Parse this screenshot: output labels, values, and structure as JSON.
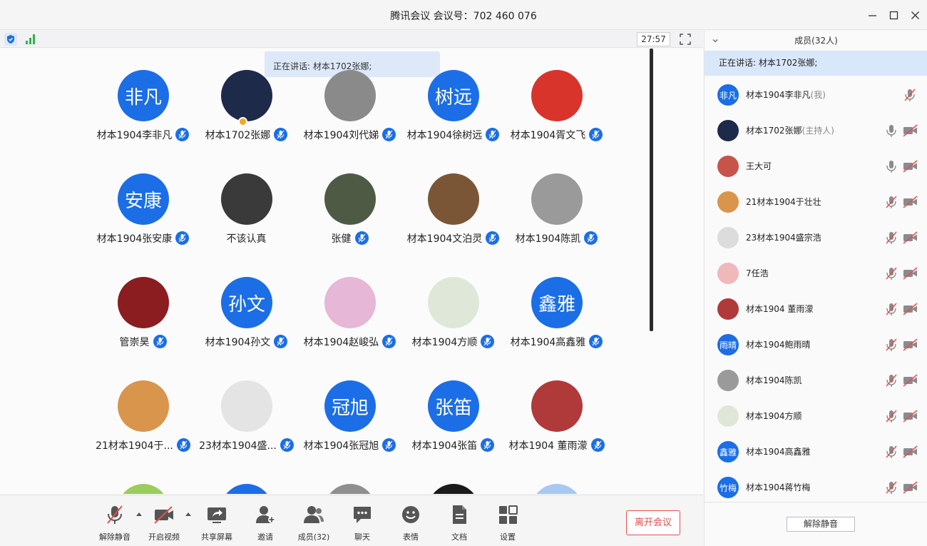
{
  "window": {
    "title": "腾讯会议 会议号：702 460 076"
  },
  "strip": {
    "timer": "27:57"
  },
  "main": {
    "speaking_tip": "正在讲话: 材本1702张娜;",
    "tiles": [
      {
        "name": "材本1904李非凡",
        "avatar_text": "非凡",
        "avatar_color": "#1b6ee6",
        "mic": true
      },
      {
        "name": "材本1702张娜",
        "avatar_text": "",
        "avatar_color": "#1d2a4a",
        "mic": true,
        "host": true
      },
      {
        "name": "材本1904刘代娣",
        "avatar_text": "",
        "avatar_color": "#8a8a8a",
        "mic": true
      },
      {
        "name": "材本1904徐树远",
        "avatar_text": "树远",
        "avatar_color": "#1b6ee6",
        "mic": true
      },
      {
        "name": "材本1904胥文飞",
        "avatar_text": "",
        "avatar_color": "#d8342c",
        "mic": true
      },
      {
        "name": "材本1904张安康",
        "avatar_text": "安康",
        "avatar_color": "#1b6ee6",
        "mic": true
      },
      {
        "name": "不该认真",
        "avatar_text": "",
        "avatar_color": "#3a3a3a",
        "mic": false
      },
      {
        "name": "张健",
        "avatar_text": "",
        "avatar_color": "#4e5a44",
        "mic": true
      },
      {
        "name": "材本1904文泊灵",
        "avatar_text": "",
        "avatar_color": "#7b5636",
        "mic": true
      },
      {
        "name": "材本1904陈凯",
        "avatar_text": "",
        "avatar_color": "#9a9a9a",
        "mic": true
      },
      {
        "name": "管崇昊",
        "avatar_text": "",
        "avatar_color": "#8b1c20",
        "mic": true
      },
      {
        "name": "材本1904孙文",
        "avatar_text": "孙文",
        "avatar_color": "#1b6ee6",
        "mic": true
      },
      {
        "name": "材本1904赵峻弘",
        "avatar_text": "",
        "avatar_color": "#e6b7d6",
        "mic": true
      },
      {
        "name": "材本1904方顺",
        "avatar_text": "",
        "avatar_color": "#dfe8d8",
        "mic": true
      },
      {
        "name": "材本1904高鑫雅",
        "avatar_text": "鑫雅",
        "avatar_color": "#1b6ee6",
        "mic": true
      },
      {
        "name": "21材本1904于...",
        "avatar_text": "",
        "avatar_color": "#d9954c",
        "mic": true
      },
      {
        "name": "23材本1904盛...",
        "avatar_text": "",
        "avatar_color": "#e4e4e4",
        "mic": true
      },
      {
        "name": "材本1904张冠旭",
        "avatar_text": "冠旭",
        "avatar_color": "#1b6ee6",
        "mic": true
      },
      {
        "name": "材本1904张笛",
        "avatar_text": "张笛",
        "avatar_color": "#1b6ee6",
        "mic": true
      },
      {
        "name": "材本1904 董雨濛",
        "avatar_text": "",
        "avatar_color": "#b0393a",
        "mic": true
      }
    ],
    "partial_row_colors": [
      "#9ccc5b",
      "#1b6ee6",
      "#8f8f8f",
      "#1a1a1a",
      "#a9c8ef"
    ]
  },
  "toolbar": {
    "unmute": "解除静音",
    "video": "开启视频",
    "share": "共享屏幕",
    "invite": "邀请",
    "members": "成员(32)",
    "chat": "聊天",
    "emoji": "表情",
    "docs": "文档",
    "settings": "设置",
    "leave": "离开会议"
  },
  "panel": {
    "header": "成员(32人)",
    "speaking": "正在讲话: 材本1702张娜;",
    "members": [
      {
        "name": "材本1904李非凡",
        "tag": "(我)",
        "avatar_text": "非凡",
        "avatar_color": "#1b6ee6",
        "mic": "muted",
        "cam": "none"
      },
      {
        "name": "材本1702张娜",
        "tag": "(主持人)",
        "avatar_text": "",
        "avatar_color": "#1d2a4a",
        "mic": "on",
        "cam": "off"
      },
      {
        "name": "王大可",
        "tag": "",
        "avatar_text": "",
        "avatar_color": "#c7544a",
        "mic": "on",
        "cam": "off"
      },
      {
        "name": "21材本1904于壮壮",
        "tag": "",
        "avatar_text": "",
        "avatar_color": "#d9954c",
        "mic": "muted",
        "cam": "off"
      },
      {
        "name": "23材本1904盛宗浩",
        "tag": "",
        "avatar_text": "",
        "avatar_color": "#dcdcdc",
        "mic": "muted",
        "cam": "off"
      },
      {
        "name": "7任浩",
        "tag": "",
        "avatar_text": "",
        "avatar_color": "#f0b8bb",
        "mic": "muted",
        "cam": "off"
      },
      {
        "name": "材本1904 董雨濛",
        "tag": "",
        "avatar_text": "",
        "avatar_color": "#b0393a",
        "mic": "muted",
        "cam": "off"
      },
      {
        "name": "材本1904鲍雨晴",
        "tag": "",
        "avatar_text": "雨晴",
        "avatar_color": "#1b6ee6",
        "mic": "muted",
        "cam": "off"
      },
      {
        "name": "材本1904陈凯",
        "tag": "",
        "avatar_text": "",
        "avatar_color": "#9a9a9a",
        "mic": "muted",
        "cam": "off"
      },
      {
        "name": "材本1904方顺",
        "tag": "",
        "avatar_text": "",
        "avatar_color": "#dfe8d8",
        "mic": "muted",
        "cam": "off"
      },
      {
        "name": "材本1904高鑫雅",
        "tag": "",
        "avatar_text": "鑫雅",
        "avatar_color": "#1b6ee6",
        "mic": "muted",
        "cam": "off"
      },
      {
        "name": "材本1904蒋竹梅",
        "tag": "",
        "avatar_text": "竹梅",
        "avatar_color": "#1b6ee6",
        "mic": "muted",
        "cam": "off"
      }
    ],
    "footer_button": "解除静音"
  },
  "colors": {
    "accent": "#1b6ee6",
    "danger": "#e2504a",
    "speaking_bg": "#d9e7fa"
  }
}
